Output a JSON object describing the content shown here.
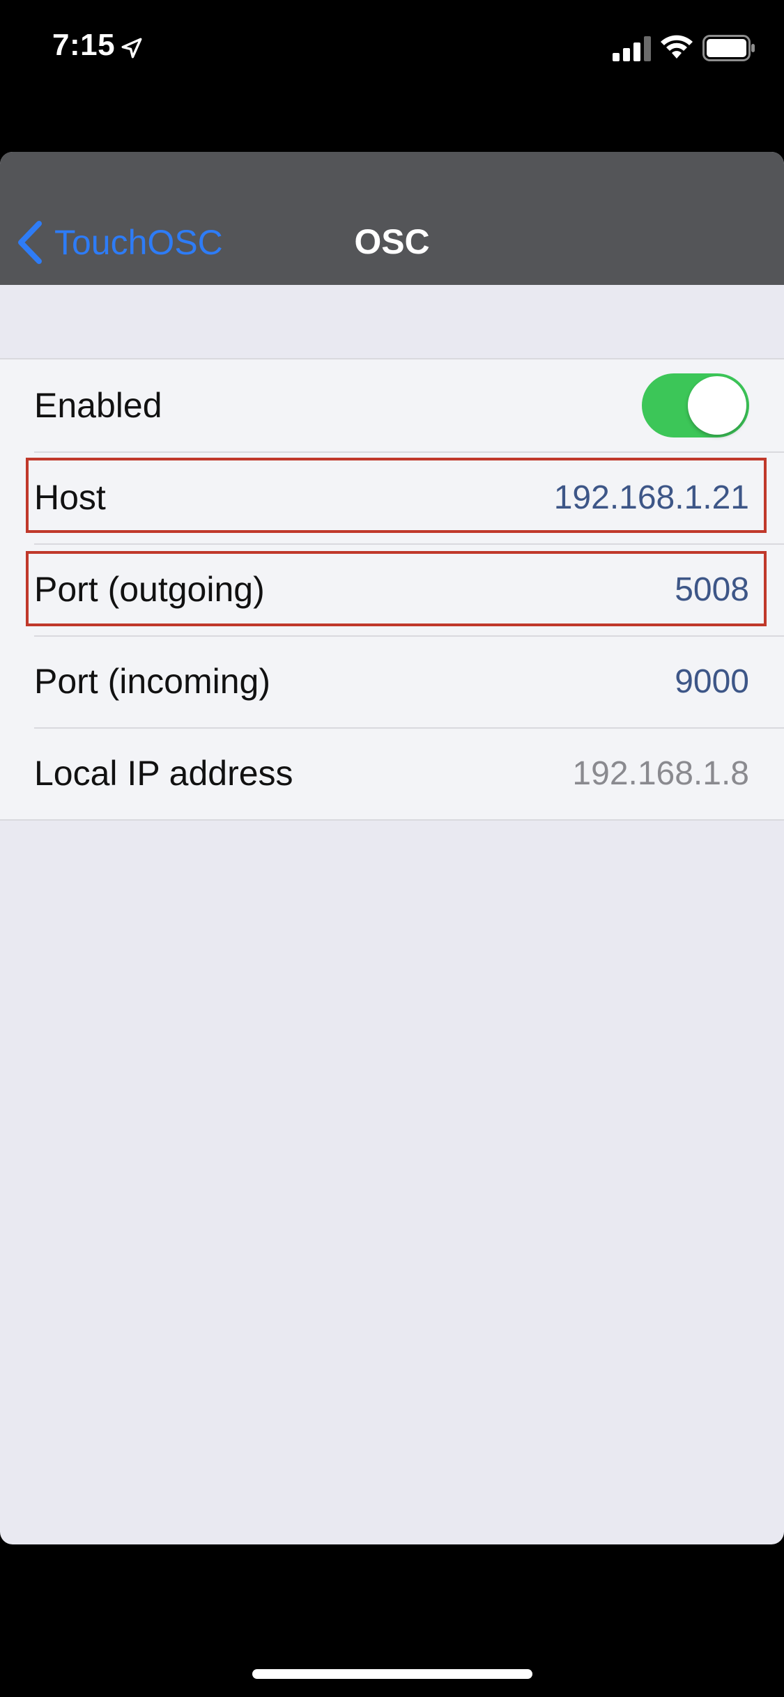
{
  "status_bar": {
    "time": "7:15",
    "icons": [
      "location-arrow-icon",
      "signal-icon",
      "wifi-icon",
      "battery-icon"
    ]
  },
  "nav": {
    "back_label": "TouchOSC",
    "title": "OSC"
  },
  "settings": {
    "enabled": {
      "label": "Enabled",
      "on": true
    },
    "host": {
      "label": "Host",
      "value": "192.168.1.21"
    },
    "port_out": {
      "label": "Port (outgoing)",
      "value": "5008"
    },
    "port_in": {
      "label": "Port (incoming)",
      "value": "9000"
    },
    "local_ip": {
      "label": "Local IP address",
      "value": "192.168.1.8"
    }
  },
  "colors": {
    "nav_background": "#545558",
    "accent_blue": "#2E7CF6",
    "value_blue": "#3D5687",
    "toggle_green": "#3CC658",
    "highlight_red": "#C0392B",
    "background": "#E9E9F1"
  }
}
